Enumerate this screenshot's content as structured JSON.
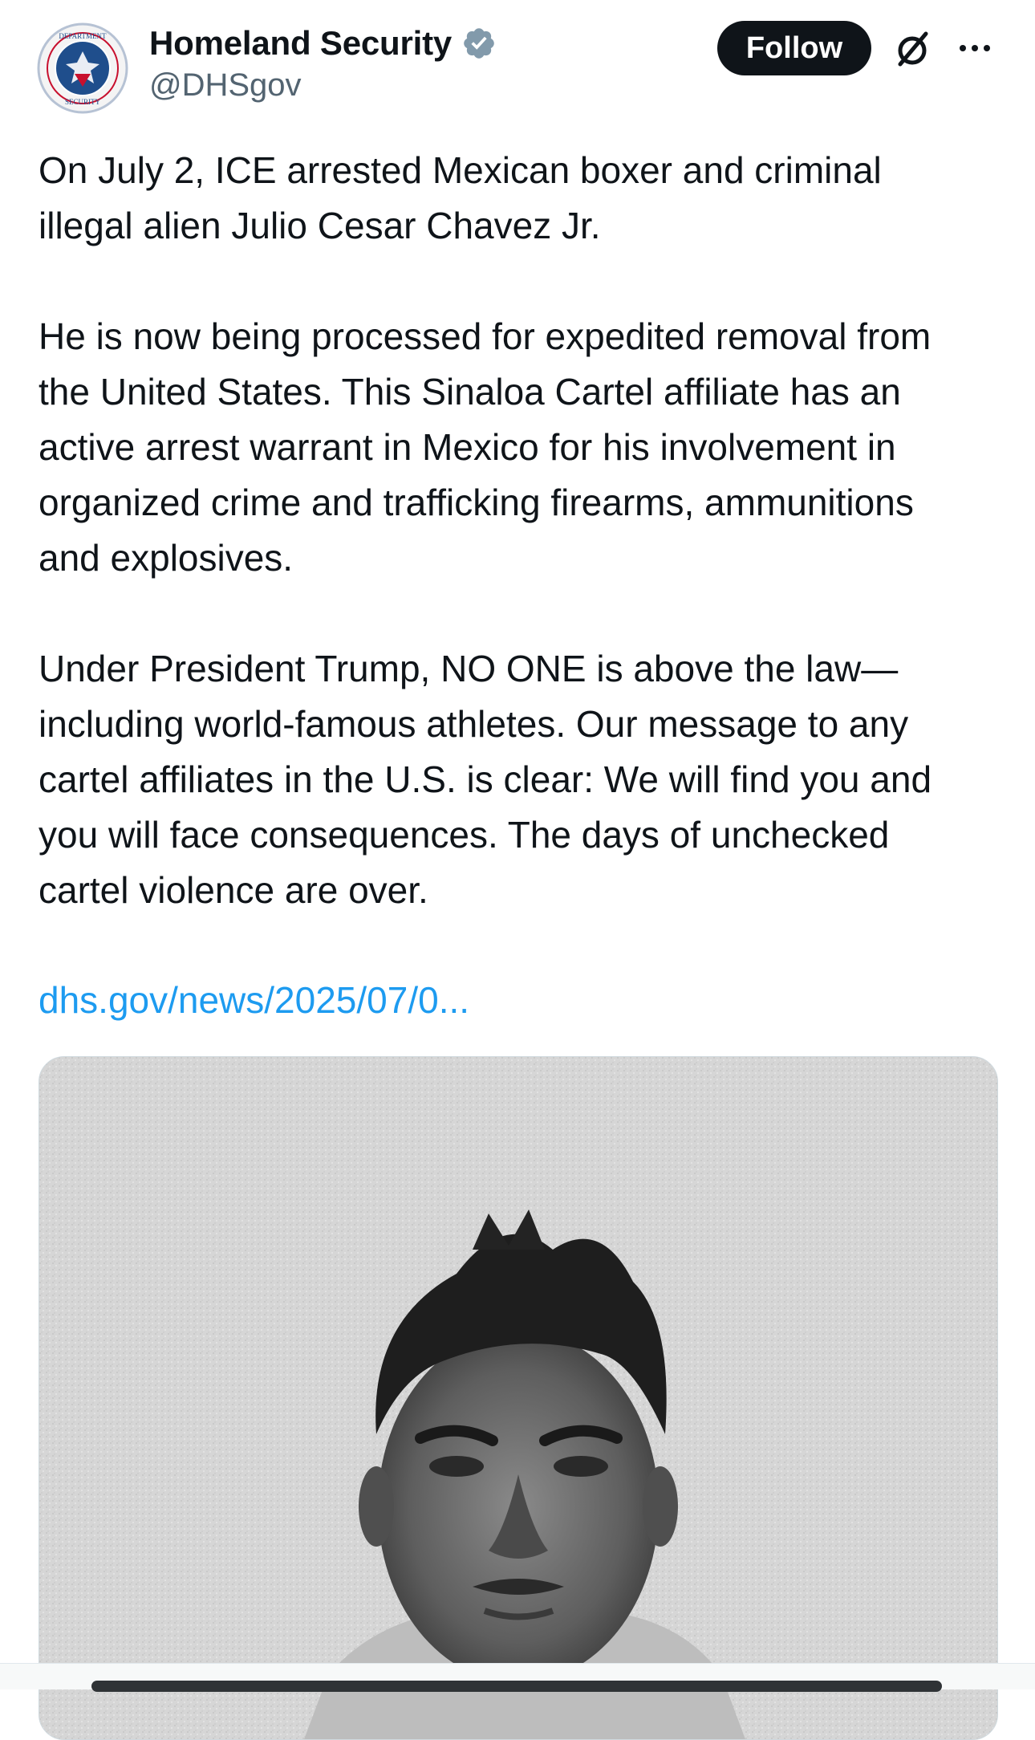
{
  "author": {
    "display_name": "Homeland Security",
    "handle": "@DHSgov",
    "avatar_icon": "dhs-seal-icon",
    "verified_icon": "verified-badge-icon",
    "verified_color": "#829aab"
  },
  "actions": {
    "follow_label": "Follow",
    "grok_icon": "grok-icon",
    "more_icon": "more-options-icon"
  },
  "tweet": {
    "paragraphs": [
      "On July 2, ICE arrested Mexican boxer and criminal\nillegal alien Julio Cesar Chavez Jr.",
      "He is now being processed for expedited removal from\nthe United States. This Sinaloa Cartel affiliate has an\nactive arrest warrant in Mexico for his involvement in\norganized crime and trafficking firearms, ammunitions\nand explosives.",
      "Under President Trump, NO ONE is above the law—\nincluding world-famous athletes. Our message to any\ncartel affiliates in the U.S. is clear: We will find you and\nyou will face consequences. The days of unchecked\ncartel violence are over."
    ],
    "link_text": "dhs.gov/news/2025/07/0...",
    "link_color": "#1d9bf0"
  },
  "media": {
    "type": "photo",
    "description_icon": "mugshot-photo"
  }
}
